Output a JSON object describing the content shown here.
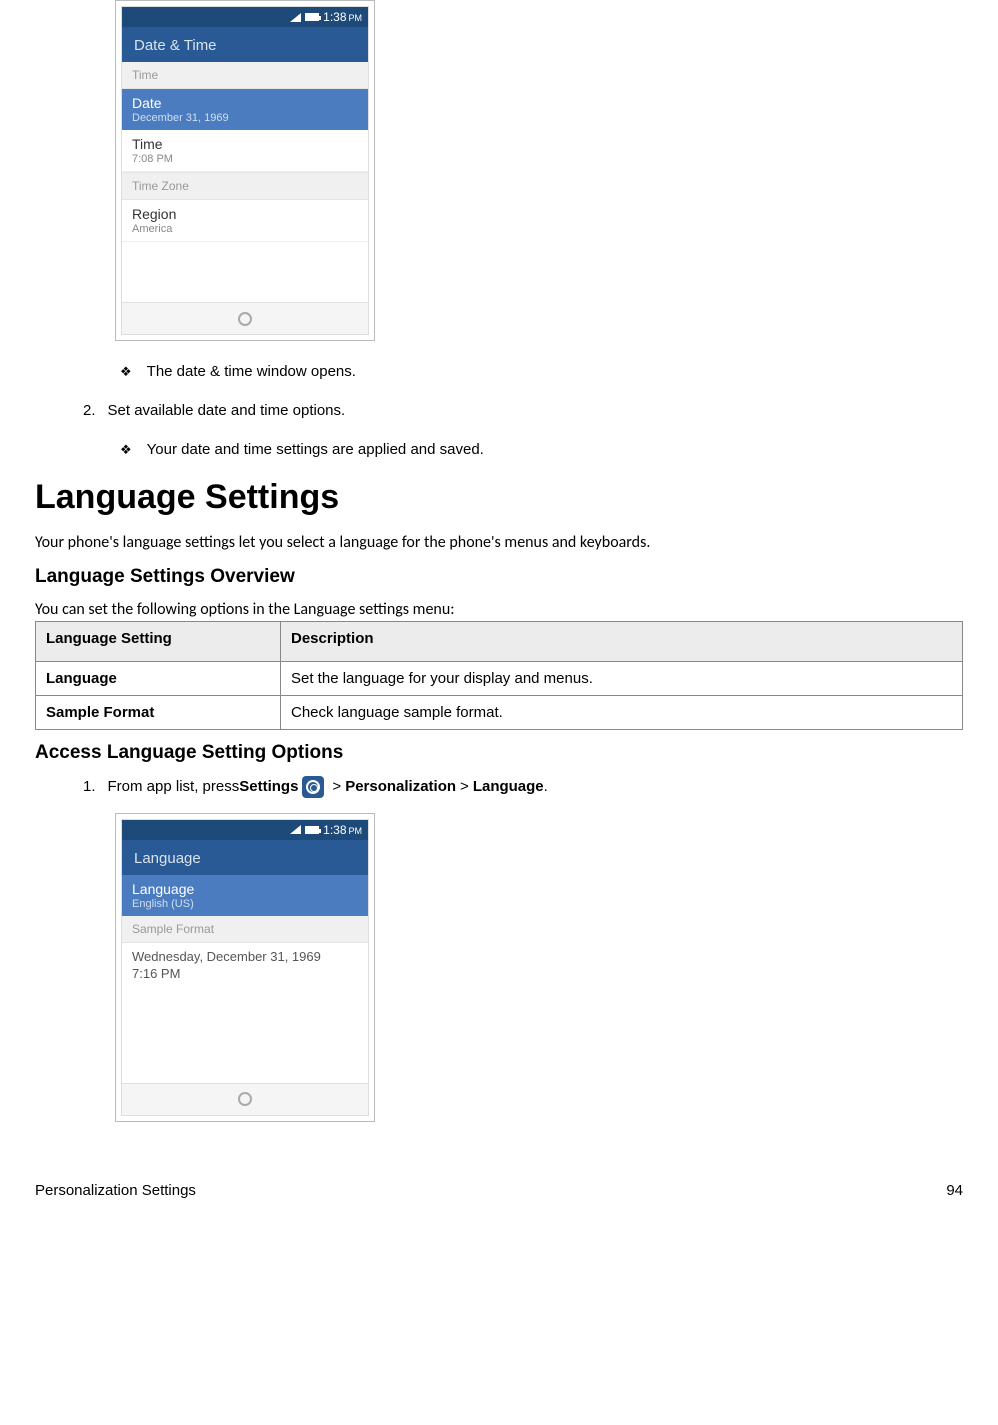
{
  "phone1": {
    "status_time": "1:38",
    "status_ampm": "PM",
    "title": "Date & Time",
    "section_time_hdr": "Time",
    "date_row": {
      "label": "Date",
      "value": "December 31, 1969"
    },
    "time_row": {
      "label": "Time",
      "value": "7:08 PM"
    },
    "timezone_hdr": "Time Zone",
    "region_row": {
      "label": "Region",
      "value": "America"
    }
  },
  "bullet1": "The date & time window opens.",
  "step2_num": "2.",
  "step2_text": "Set available date and time options.",
  "bullet2": "Your date and time settings are applied and saved.",
  "h1": "Language Settings",
  "intro": "Your phone's language settings let you select a language for the phone's menus and keyboards.",
  "h2a": "Language Settings Overview",
  "subtext": "You can set the following options in the Language settings menu:",
  "table": {
    "header": {
      "col1": "Language Setting",
      "col2": "Description"
    },
    "rows": [
      {
        "label": "Language",
        "desc": "Set the language for your display and menus."
      },
      {
        "label": "Sample Format",
        "desc": "Check language sample format."
      }
    ]
  },
  "h2b": "Access Language Setting Options",
  "step1": {
    "num": "1.",
    "prefix": "From app list, press ",
    "settings": "Settings",
    "gt1": " > ",
    "personalization": "Personalization",
    "gt2": " > ",
    "language": "Language",
    "suffix": "."
  },
  "phone2": {
    "status_time": "1:38",
    "status_ampm": "PM",
    "title": "Language",
    "lang_row": {
      "label": "Language",
      "value": "English (US)"
    },
    "sample_hdr": "Sample Format",
    "sample_line1": "Wednesday, December 31, 1969",
    "sample_line2": "7:16 PM"
  },
  "footer": {
    "left": "Personalization Settings",
    "right": "94"
  }
}
